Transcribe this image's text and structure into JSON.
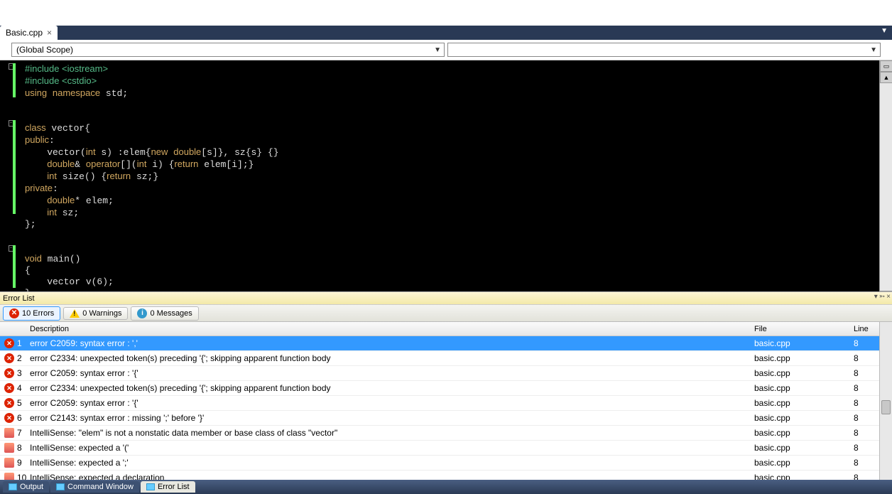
{
  "tab": {
    "name": "Basic.cpp"
  },
  "scope": {
    "label": "(Global Scope)"
  },
  "code_lines": [
    {
      "t": "pre",
      "s": "#include <iostream>"
    },
    {
      "t": "pre",
      "s": "#include <cstdio>"
    },
    {
      "t": "kw",
      "s": "using namespace std;"
    },
    {
      "t": "",
      "s": ""
    },
    {
      "t": "",
      "s": ""
    },
    {
      "t": "cls",
      "s": "class vector{"
    },
    {
      "t": "kw2",
      "s": "public:"
    },
    {
      "t": "body",
      "s": "    vector(int s) :elem{new double[s]}, sz{s} {}"
    },
    {
      "t": "body",
      "s": "    double& operator[](int i) {return elem[i];}"
    },
    {
      "t": "body",
      "s": "    int size() {return sz;}"
    },
    {
      "t": "kw2",
      "s": "private:"
    },
    {
      "t": "body2",
      "s": "    double* elem;"
    },
    {
      "t": "body2",
      "s": "    int sz;"
    },
    {
      "t": "",
      "s": "};"
    },
    {
      "t": "",
      "s": ""
    },
    {
      "t": "",
      "s": ""
    },
    {
      "t": "fn",
      "s": "void main()"
    },
    {
      "t": "",
      "s": "{"
    },
    {
      "t": "body",
      "s": "    vector v(6);"
    },
    {
      "t": "",
      "s": "}"
    }
  ],
  "errorlist": {
    "title": "Error List",
    "filters": {
      "errors": "10 Errors",
      "warnings": "0 Warnings",
      "messages": "0 Messages"
    },
    "cols": {
      "desc": "Description",
      "file": "File",
      "line": "Line"
    },
    "rows": [
      {
        "n": "1",
        "icon": "err",
        "desc": "error C2059: syntax error : ','",
        "file": "basic.cpp",
        "line": "8",
        "sel": true
      },
      {
        "n": "2",
        "icon": "err",
        "desc": "error C2334: unexpected token(s) preceding '{'; skipping apparent function body",
        "file": "basic.cpp",
        "line": "8"
      },
      {
        "n": "3",
        "icon": "err",
        "desc": "error C2059: syntax error : '{'",
        "file": "basic.cpp",
        "line": "8"
      },
      {
        "n": "4",
        "icon": "err",
        "desc": "error C2334: unexpected token(s) preceding '{'; skipping apparent function body",
        "file": "basic.cpp",
        "line": "8"
      },
      {
        "n": "5",
        "icon": "err",
        "desc": "error C2059: syntax error : '{'",
        "file": "basic.cpp",
        "line": "8"
      },
      {
        "n": "6",
        "icon": "err",
        "desc": "error C2143: syntax error : missing ';' before '}'",
        "file": "basic.cpp",
        "line": "8"
      },
      {
        "n": "7",
        "icon": "intel",
        "desc": "IntelliSense: \"elem\" is not a nonstatic data member or base class of class \"vector\"",
        "file": "basic.cpp",
        "line": "8"
      },
      {
        "n": "8",
        "icon": "intel",
        "desc": "IntelliSense: expected a '('",
        "file": "basic.cpp",
        "line": "8"
      },
      {
        "n": "9",
        "icon": "intel",
        "desc": "IntelliSense: expected a ';'",
        "file": "basic.cpp",
        "line": "8"
      },
      {
        "n": "10",
        "icon": "intel",
        "desc": "IntelliSense: expected a declaration",
        "file": "basic.cpp",
        "line": "8"
      }
    ]
  },
  "bottom_tabs": {
    "output": "Output",
    "cmd": "Command Window",
    "errlist": "Error List"
  }
}
